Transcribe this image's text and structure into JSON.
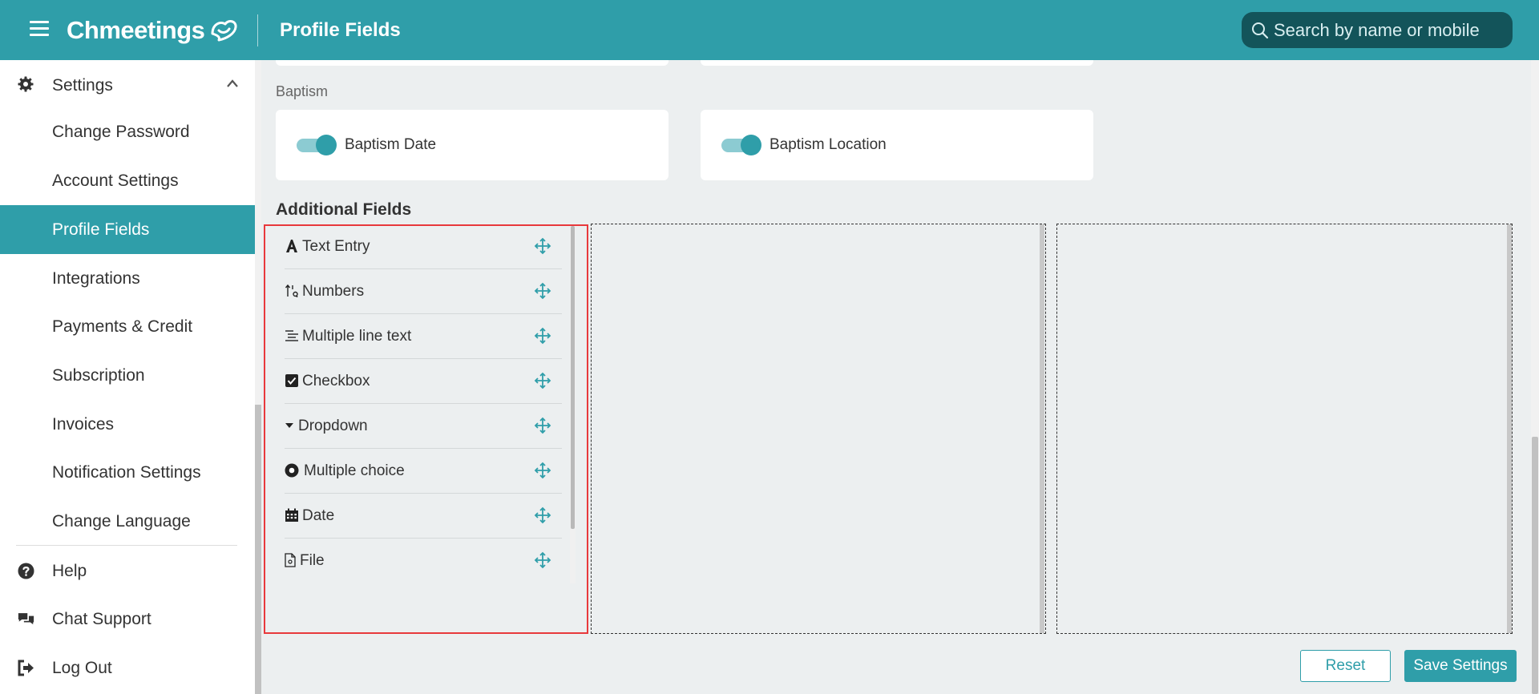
{
  "header": {
    "brand": "Chmeetings",
    "page_title": "Profile Fields",
    "search_placeholder": "Search by name or mobile"
  },
  "sidebar": {
    "section": "Settings",
    "items": [
      {
        "label": "Change Password"
      },
      {
        "label": "Account Settings"
      },
      {
        "label": "Profile Fields"
      },
      {
        "label": "Integrations"
      },
      {
        "label": "Payments & Credit"
      },
      {
        "label": "Subscription"
      },
      {
        "label": "Invoices"
      },
      {
        "label": "Notification Settings"
      },
      {
        "label": "Change Language"
      }
    ],
    "bottom": [
      {
        "label": "Help",
        "icon": "help-icon"
      },
      {
        "label": "Chat Support",
        "icon": "chat-icon"
      },
      {
        "label": "Log Out",
        "icon": "logout-icon"
      }
    ]
  },
  "baptism": {
    "section_label": "Baptism",
    "fields": [
      {
        "label": "Baptism Date",
        "enabled": true
      },
      {
        "label": "Baptism Location",
        "enabled": true
      }
    ]
  },
  "additional": {
    "title": "Additional Fields",
    "field_types": [
      {
        "label": "Text Entry",
        "icon": "text-icon"
      },
      {
        "label": "Numbers",
        "icon": "numbers-icon"
      },
      {
        "label": "Multiple line text",
        "icon": "multiline-icon"
      },
      {
        "label": "Checkbox",
        "icon": "checkbox-icon"
      },
      {
        "label": "Dropdown",
        "icon": "dropdown-icon"
      },
      {
        "label": "Multiple choice",
        "icon": "radio-icon"
      },
      {
        "label": "Date",
        "icon": "calendar-icon"
      },
      {
        "label": "File",
        "icon": "file-icon"
      }
    ]
  },
  "actions": {
    "reset": "Reset",
    "save": "Save Settings"
  },
  "colors": {
    "primary": "#2f9ea9",
    "search_bg": "#13545a",
    "highlight_border": "#e8393c"
  }
}
